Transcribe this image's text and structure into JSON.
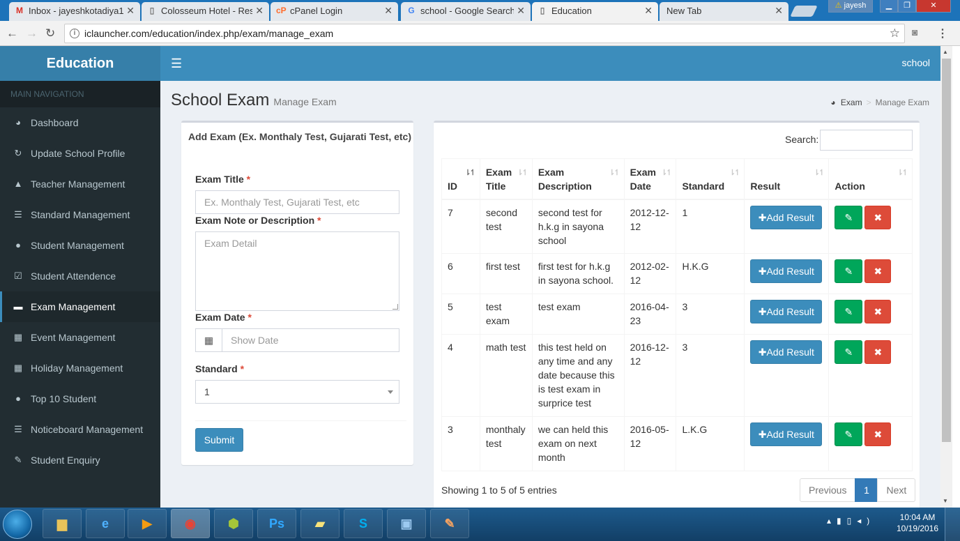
{
  "browser": {
    "tabs": [
      {
        "favicon": "gmail-icon",
        "title": "Inbox - jayeshkotadiya1",
        "active": false
      },
      {
        "favicon": "page-icon",
        "title": "Colosseum Hotel - Resp",
        "active": false
      },
      {
        "favicon": "cpanel-icon",
        "title": "cPanel Login",
        "active": false
      },
      {
        "favicon": "google-icon",
        "title": "school - Google Search",
        "active": false
      },
      {
        "favicon": "page-icon",
        "title": "Education",
        "active": true
      },
      {
        "favicon": "",
        "title": "New Tab",
        "active": false
      }
    ],
    "profile_name": "jayesh",
    "url": "iclauncher.com/education/index.php/exam/manage_exam"
  },
  "app": {
    "logo": "Education",
    "user_label": "school"
  },
  "sidebar": {
    "header": "MAIN NAVIGATION",
    "items": [
      {
        "label": "Dashboard",
        "icon": "dashboard-icon"
      },
      {
        "label": "Update School Profile",
        "icon": "refresh-icon"
      },
      {
        "label": "Teacher Management",
        "icon": "graduation-cap-icon"
      },
      {
        "label": "Standard Management",
        "icon": "list-icon"
      },
      {
        "label": "Student Management",
        "icon": "user-icon"
      },
      {
        "label": "Student Attendence",
        "icon": "calendar-check-icon"
      },
      {
        "label": "Exam Management",
        "icon": "briefcase-icon",
        "active": true
      },
      {
        "label": "Event Management",
        "icon": "calendar-icon"
      },
      {
        "label": "Holiday Management",
        "icon": "calendar-icon"
      },
      {
        "label": "Top 10 Student",
        "icon": "user-icon"
      },
      {
        "label": "Noticeboard Management",
        "icon": "list-icon"
      },
      {
        "label": "Student Enquiry",
        "icon": "edit-icon"
      }
    ]
  },
  "page": {
    "title": "School Exam",
    "subtitle": "Manage Exam",
    "breadcrumb": [
      "Exam",
      "Manage Exam"
    ]
  },
  "form": {
    "title": "Add Exam (Ex. Monthaly Test, Gujarati Test, etc)",
    "exam_title_label": "Exam Title",
    "exam_title_placeholder": "Ex. Monthaly Test, Gujarati Test, etc",
    "description_label": "Exam Note or Description",
    "description_placeholder": "Exam Detail",
    "date_label": "Exam Date",
    "date_placeholder": "Show Date",
    "standard_label": "Standard",
    "standard_value": "1",
    "required_mark": "*",
    "submit_label": "Submit"
  },
  "table": {
    "search_label": "Search:",
    "columns": [
      "ID",
      "Exam Title",
      "Exam Description",
      "Exam Date",
      "Standard",
      "Result",
      "Action"
    ],
    "rows": [
      {
        "id": "7",
        "title": "second test",
        "description": "second test for h.k.g in sayona school",
        "date": "2012-12-12",
        "standard": "1"
      },
      {
        "id": "6",
        "title": "first test",
        "description": "first test for h.k.g in sayona school.",
        "date": "2012-02-12",
        "standard": "H.K.G"
      },
      {
        "id": "5",
        "title": "test exam",
        "description": "test exam",
        "date": "2016-04-23",
        "standard": "3"
      },
      {
        "id": "4",
        "title": "math test",
        "description": "this test held on any time and any date because this is test exam in surprice test",
        "date": "2016-12-12",
        "standard": "3"
      },
      {
        "id": "3",
        "title": "monthaly test",
        "description": "we can held this exam on next month",
        "date": "2016-05-12",
        "standard": "L.K.G"
      }
    ],
    "add_result_label": "Add Result",
    "info": "Showing 1 to 5 of 5 entries",
    "pagination": {
      "previous": "Previous",
      "current": "1",
      "next": "Next"
    }
  },
  "taskbar": {
    "time": "10:04 AM",
    "date": "10/19/2016"
  },
  "colors": {
    "primary": "#3c8dbc",
    "sidebar_bg": "#222d32",
    "success": "#00a65a",
    "danger": "#dd4b39"
  }
}
